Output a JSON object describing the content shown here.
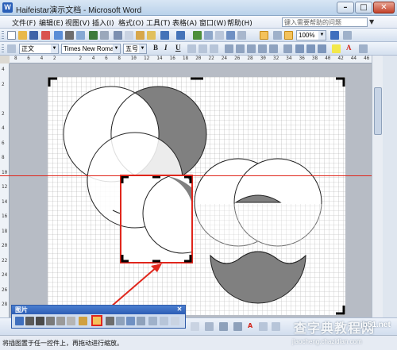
{
  "window": {
    "title": "Haifeistar演示文档 - Microsoft Word",
    "app_icon": "W"
  },
  "menu": {
    "items": [
      "文件(F)",
      "编辑(E)",
      "视图(V)",
      "插入(I)",
      "格式(O)",
      "工具(T)",
      "表格(A)",
      "窗口(W)",
      "帮助(H)"
    ],
    "help_placeholder": "键入需要帮助的问题"
  },
  "toolbar_standard": {
    "zoom": "100%"
  },
  "toolbar_format": {
    "style": "正文",
    "font": "Times New Roman",
    "size": "五号",
    "bold": "B",
    "italic": "I",
    "underline": "U",
    "text_a": "A"
  },
  "ruler": {
    "h_labels": [
      "8",
      "6",
      "4",
      "2",
      "",
      "2",
      "4",
      "6",
      "8",
      "10",
      "12",
      "14",
      "16",
      "18",
      "20",
      "22",
      "24",
      "26",
      "28",
      "30",
      "32",
      "34",
      "36",
      "38",
      "40",
      "42",
      "44",
      "46"
    ],
    "v_labels": [
      "4",
      "2",
      "",
      "2",
      "4",
      "6",
      "8",
      "10",
      "12",
      "14",
      "16",
      "18",
      "20",
      "22",
      "24",
      "26",
      "28"
    ]
  },
  "picture_toolbar": {
    "title": "图片"
  },
  "status": {
    "text": "将插图置于任一控件上，再拖动进行缩放。"
  },
  "watermark": {
    "line1": "查字典教程网",
    "site": "jb51.net",
    "line2": "jiaocheng.chazidian.com"
  },
  "colors": {
    "accent_red": "#e0261c",
    "shape_fill": "#808080",
    "title_blue": "#2d5db5"
  }
}
